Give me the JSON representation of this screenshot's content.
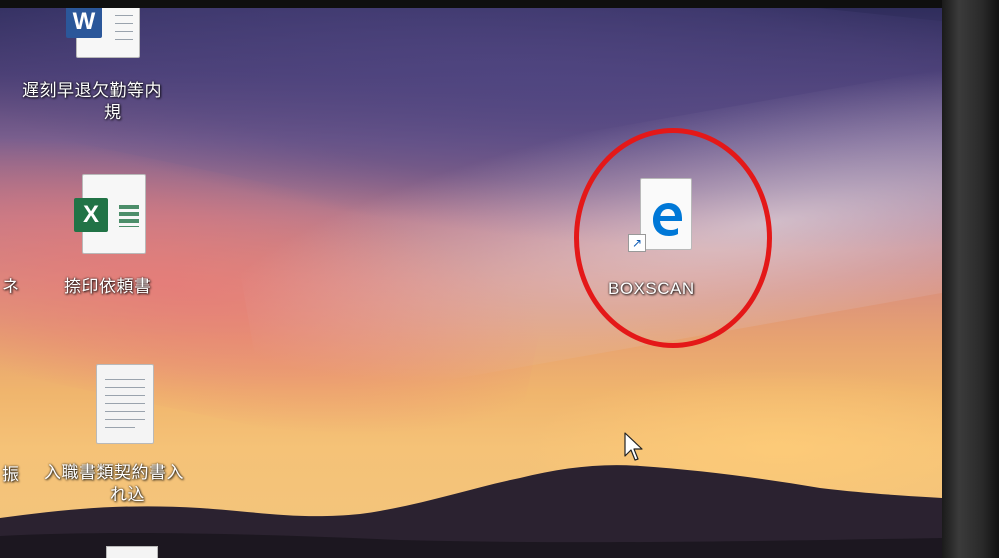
{
  "desktop": {
    "icons": [
      {
        "label_line1": "遅刻早退欠勤等内",
        "label_line2": "規",
        "type": "word-document-icon"
      },
      {
        "label_line1": "捺印依頼書",
        "type": "excel-spreadsheet-icon"
      },
      {
        "label_line1": "BOXSCAN",
        "type": "edge-shortcut-icon"
      },
      {
        "label_line1": "入職書類契約書入",
        "label_line2": "れ込",
        "type": "text-document-icon"
      }
    ],
    "edge_fragments": {
      "left_top": "ネ",
      "left_bottom": "振"
    }
  },
  "annotation": {
    "highlight_color": "#e41818",
    "highlight_target": "BOXSCAN"
  },
  "colors": {
    "word_blue": "#2b579a",
    "excel_green": "#217346",
    "edge_blue": "#0078d7"
  }
}
